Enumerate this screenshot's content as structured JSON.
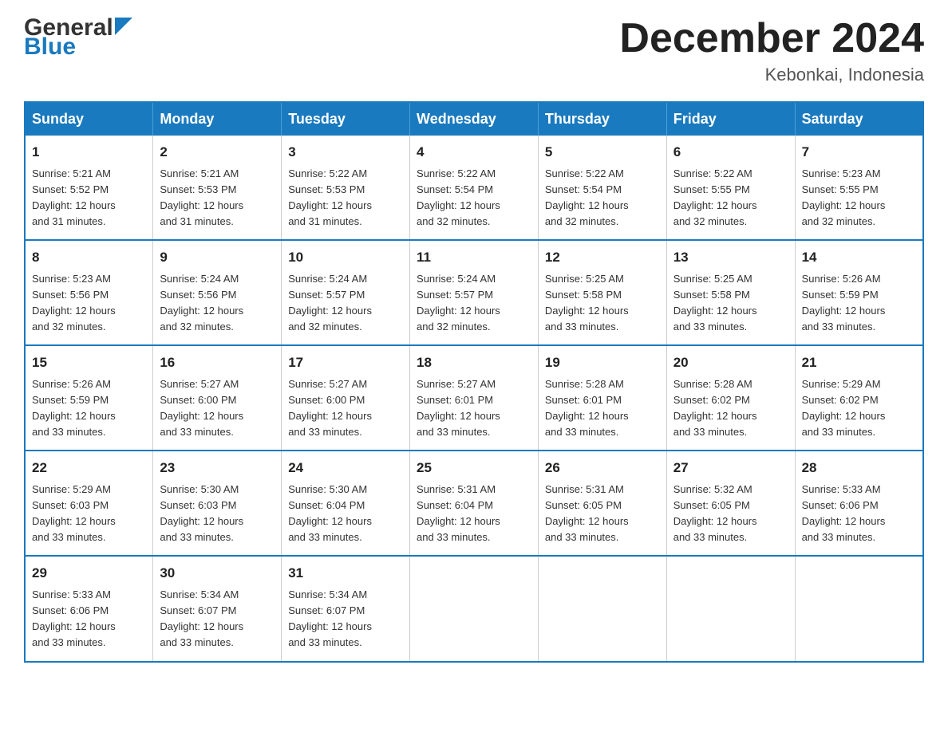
{
  "header": {
    "logo_general": "General",
    "logo_blue": "Blue",
    "month_title": "December 2024",
    "location": "Kebonkai, Indonesia"
  },
  "days_of_week": [
    "Sunday",
    "Monday",
    "Tuesday",
    "Wednesday",
    "Thursday",
    "Friday",
    "Saturday"
  ],
  "weeks": [
    [
      {
        "day": "1",
        "sunrise": "5:21 AM",
        "sunset": "5:52 PM",
        "daylight": "12 hours and 31 minutes."
      },
      {
        "day": "2",
        "sunrise": "5:21 AM",
        "sunset": "5:53 PM",
        "daylight": "12 hours and 31 minutes."
      },
      {
        "day": "3",
        "sunrise": "5:22 AM",
        "sunset": "5:53 PM",
        "daylight": "12 hours and 31 minutes."
      },
      {
        "day": "4",
        "sunrise": "5:22 AM",
        "sunset": "5:54 PM",
        "daylight": "12 hours and 32 minutes."
      },
      {
        "day": "5",
        "sunrise": "5:22 AM",
        "sunset": "5:54 PM",
        "daylight": "12 hours and 32 minutes."
      },
      {
        "day": "6",
        "sunrise": "5:22 AM",
        "sunset": "5:55 PM",
        "daylight": "12 hours and 32 minutes."
      },
      {
        "day": "7",
        "sunrise": "5:23 AM",
        "sunset": "5:55 PM",
        "daylight": "12 hours and 32 minutes."
      }
    ],
    [
      {
        "day": "8",
        "sunrise": "5:23 AM",
        "sunset": "5:56 PM",
        "daylight": "12 hours and 32 minutes."
      },
      {
        "day": "9",
        "sunrise": "5:24 AM",
        "sunset": "5:56 PM",
        "daylight": "12 hours and 32 minutes."
      },
      {
        "day": "10",
        "sunrise": "5:24 AM",
        "sunset": "5:57 PM",
        "daylight": "12 hours and 32 minutes."
      },
      {
        "day": "11",
        "sunrise": "5:24 AM",
        "sunset": "5:57 PM",
        "daylight": "12 hours and 32 minutes."
      },
      {
        "day": "12",
        "sunrise": "5:25 AM",
        "sunset": "5:58 PM",
        "daylight": "12 hours and 33 minutes."
      },
      {
        "day": "13",
        "sunrise": "5:25 AM",
        "sunset": "5:58 PM",
        "daylight": "12 hours and 33 minutes."
      },
      {
        "day": "14",
        "sunrise": "5:26 AM",
        "sunset": "5:59 PM",
        "daylight": "12 hours and 33 minutes."
      }
    ],
    [
      {
        "day": "15",
        "sunrise": "5:26 AM",
        "sunset": "5:59 PM",
        "daylight": "12 hours and 33 minutes."
      },
      {
        "day": "16",
        "sunrise": "5:27 AM",
        "sunset": "6:00 PM",
        "daylight": "12 hours and 33 minutes."
      },
      {
        "day": "17",
        "sunrise": "5:27 AM",
        "sunset": "6:00 PM",
        "daylight": "12 hours and 33 minutes."
      },
      {
        "day": "18",
        "sunrise": "5:27 AM",
        "sunset": "6:01 PM",
        "daylight": "12 hours and 33 minutes."
      },
      {
        "day": "19",
        "sunrise": "5:28 AM",
        "sunset": "6:01 PM",
        "daylight": "12 hours and 33 minutes."
      },
      {
        "day": "20",
        "sunrise": "5:28 AM",
        "sunset": "6:02 PM",
        "daylight": "12 hours and 33 minutes."
      },
      {
        "day": "21",
        "sunrise": "5:29 AM",
        "sunset": "6:02 PM",
        "daylight": "12 hours and 33 minutes."
      }
    ],
    [
      {
        "day": "22",
        "sunrise": "5:29 AM",
        "sunset": "6:03 PM",
        "daylight": "12 hours and 33 minutes."
      },
      {
        "day": "23",
        "sunrise": "5:30 AM",
        "sunset": "6:03 PM",
        "daylight": "12 hours and 33 minutes."
      },
      {
        "day": "24",
        "sunrise": "5:30 AM",
        "sunset": "6:04 PM",
        "daylight": "12 hours and 33 minutes."
      },
      {
        "day": "25",
        "sunrise": "5:31 AM",
        "sunset": "6:04 PM",
        "daylight": "12 hours and 33 minutes."
      },
      {
        "day": "26",
        "sunrise": "5:31 AM",
        "sunset": "6:05 PM",
        "daylight": "12 hours and 33 minutes."
      },
      {
        "day": "27",
        "sunrise": "5:32 AM",
        "sunset": "6:05 PM",
        "daylight": "12 hours and 33 minutes."
      },
      {
        "day": "28",
        "sunrise": "5:33 AM",
        "sunset": "6:06 PM",
        "daylight": "12 hours and 33 minutes."
      }
    ],
    [
      {
        "day": "29",
        "sunrise": "5:33 AM",
        "sunset": "6:06 PM",
        "daylight": "12 hours and 33 minutes."
      },
      {
        "day": "30",
        "sunrise": "5:34 AM",
        "sunset": "6:07 PM",
        "daylight": "12 hours and 33 minutes."
      },
      {
        "day": "31",
        "sunrise": "5:34 AM",
        "sunset": "6:07 PM",
        "daylight": "12 hours and 33 minutes."
      },
      null,
      null,
      null,
      null
    ]
  ],
  "labels": {
    "sunrise": "Sunrise:",
    "sunset": "Sunset:",
    "daylight": "Daylight:"
  }
}
